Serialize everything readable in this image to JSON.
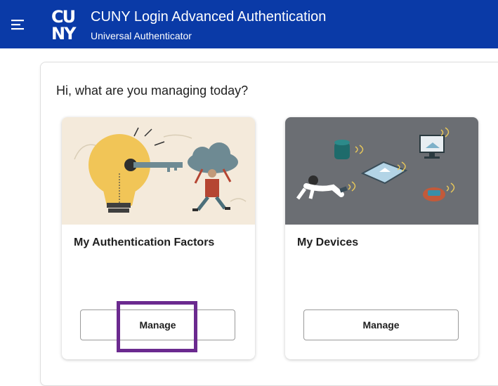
{
  "header": {
    "logo_text_top": "CU",
    "logo_text_bottom": "NY",
    "title": "CUNY Login Advanced Authentication",
    "subtitle": "Universal Authenticator",
    "brand_color": "#0a3aa7"
  },
  "main": {
    "greeting": "Hi, what are you managing today?",
    "cards": [
      {
        "title": "My Authentication Factors",
        "button_label": "Manage",
        "image": "lightbulb-key-cloud-illustration"
      },
      {
        "title": "My Devices",
        "button_label": "Manage",
        "image": "connected-devices-illustration"
      }
    ],
    "highlight_color": "#6b2a8f"
  }
}
